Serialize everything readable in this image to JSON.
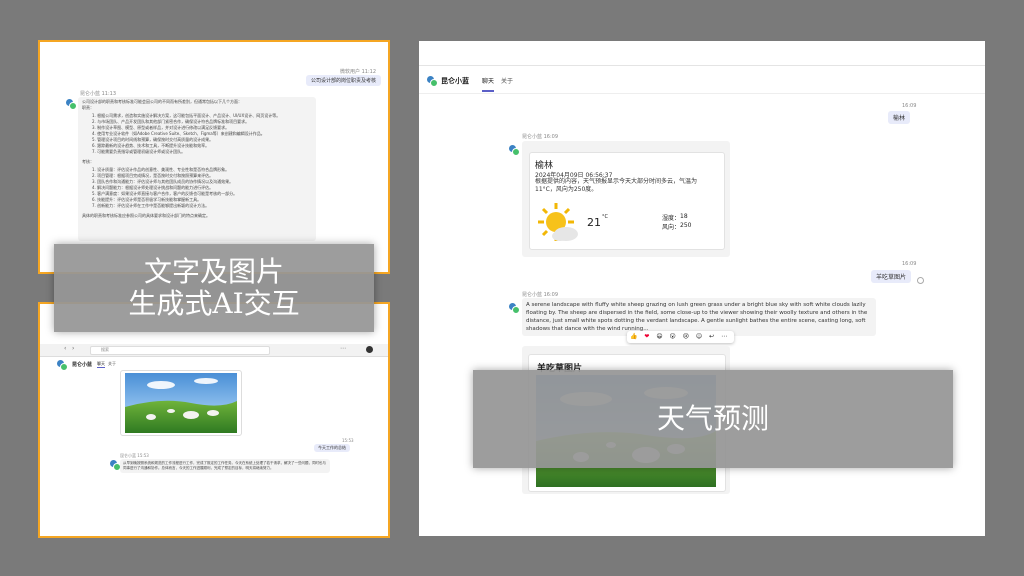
{
  "left_top": {
    "sender_meta": "微软用户 11:12",
    "user_msg": "公司设计部的岗位职责及考核",
    "bot_meta": "昆仑小蓝 11:13",
    "intro": "公司设计部的职责和考核标准可能会因公司的不同而有所差别，但通常包括以下几个方面：",
    "duties_label": "职责：",
    "duties": [
      "1. 根据公司需求，创造和实施设计解决方案，这可能包括平面设计、产品设计、UI/UX设计、网页设计等。",
      "2. 与市场团队、产品开发团队和其他部门紧密合作，确保设计符合品牌标准和项目要求。",
      "3. 制作设计草图、模型、原型或者样品，并对设计进行修改以满足反馈要求。",
      "4. 使用专业设计软件（如Adobe Creative Suite、Sketch、Figma等）来创建和编辑设计作品。",
      "5. 管理设计项目的时间线和预算，确保按时交付高质量的设计成果。",
      "6. 跟踪最新的设计趋势、技术和工具，不断提升设计技能和效率。",
      "7. 可能需要负责指导或管理初级设计师或设计团队。"
    ],
    "assess_label": "考核：",
    "assess": [
      "1. 设计质量：评估设计作品的创意性、美观性、专业性和是否符合品牌形象。",
      "2. 项目管理：根据项目完成情况，是否按时交付和按照预算来评估。",
      "3. 团队合作和沟通能力：评估设计师与其他团队成员的协作情况以及沟通效果。",
      "4. 解决问题能力：根据设计师处理设计挑战和问题的能力进行评估。",
      "5. 客户满意度：如果设计师直接与客户合作，客户的反馈也可能是考核的一部分。",
      "6. 技能提升：评估设计师是否积极学习新技能和掌握新工具。",
      "7. 创新能力：评估设计师在工作中是否能够提出新颖的设计方法。"
    ],
    "closing": "具体的职责和考核标准应参照公司的具体要求和设计部门的特点来确定。"
  },
  "left_bottom": {
    "search_placeholder": "搜索",
    "app_name": "昆仑小蓝",
    "tab_chat": "聊天",
    "tab_about": "关于",
    "time1": "15:53",
    "user_msg": "今天工作的总结",
    "bot_meta": "昆仑小蓝 15:53",
    "bot_text": "从早到晚按照系统和规范的工作流程进行工作，完成了既定的工作任务。今天在系统上处理了若干请求，解决了一些问题，同时也与同事进行了沟通和协作。总体而言，今天的工作进展顺利，完成了预定的目标，明天将继续努力。"
  },
  "overlay_left": {
    "line1": "文字及图片",
    "line2": "生成式AI交互"
  },
  "right": {
    "app_name": "昆仑小蓝",
    "tab_chat": "聊天",
    "tab_about": "关于",
    "time1": "16:09",
    "user_msg1": "榆林",
    "bot_meta1": "昆仑小蓝 16:09",
    "weather": {
      "city": "榆林",
      "datetime": "2024年04月09日 06:56:37",
      "desc": "根据提供的内容，天气预报显示今天大部分时间多云，气温为11°C，风向为250度。",
      "temp": "21",
      "unit": "°C",
      "humidity_label": "湿度：",
      "humidity": "18",
      "wind_label": "风向：",
      "wind": "250"
    },
    "time2": "16:09",
    "user_msg2": "羊吃草图片",
    "bot_meta2": "昆仑小蓝 16:09",
    "bot_text2": "A serene landscape with fluffy white sheep grazing on lush green grass under a bright blue sky with soft white clouds lazily floating by. The sheep are dispersed in the field, some close-up to the viewer showing their woolly texture and others in the distance, just small white spots dotting the verdant landscape. A gentle sunlight bathes the entire scene, casting long, soft shadows that dance with the wind running...",
    "image_title": "羊吃草图片",
    "reactions": [
      "👍",
      "❤",
      "😄",
      "😮",
      "😢",
      "☺",
      "↩",
      "⋯"
    ]
  },
  "overlay_right": {
    "text": "天气预测"
  }
}
